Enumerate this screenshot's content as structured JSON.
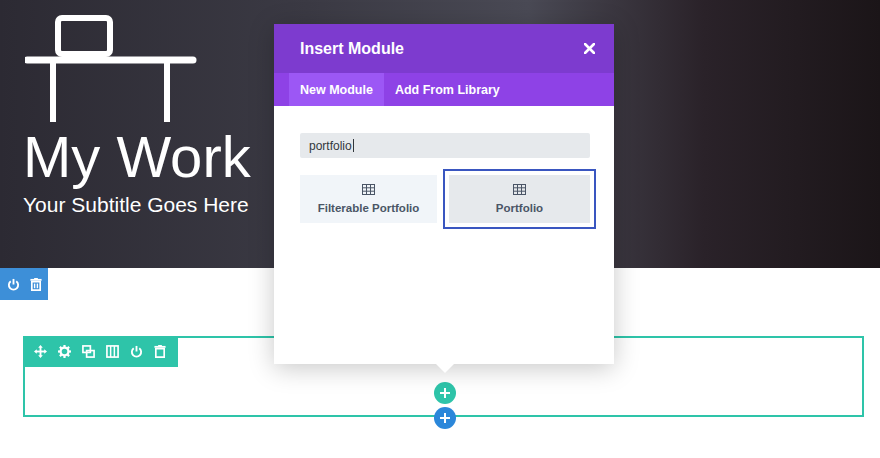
{
  "hero": {
    "title": "My Work",
    "subtitle": "Your Subtitle Goes Here"
  },
  "modal": {
    "title": "Insert Module",
    "tabs": [
      {
        "label": "New Module",
        "selected": true
      },
      {
        "label": "Add From Library",
        "selected": false
      }
    ],
    "search": {
      "value": "portfolio",
      "focused": true
    },
    "modules": [
      {
        "label": "Filterable Portfolio",
        "selected": false
      },
      {
        "label": "Portfolio",
        "selected": true
      }
    ]
  }
}
